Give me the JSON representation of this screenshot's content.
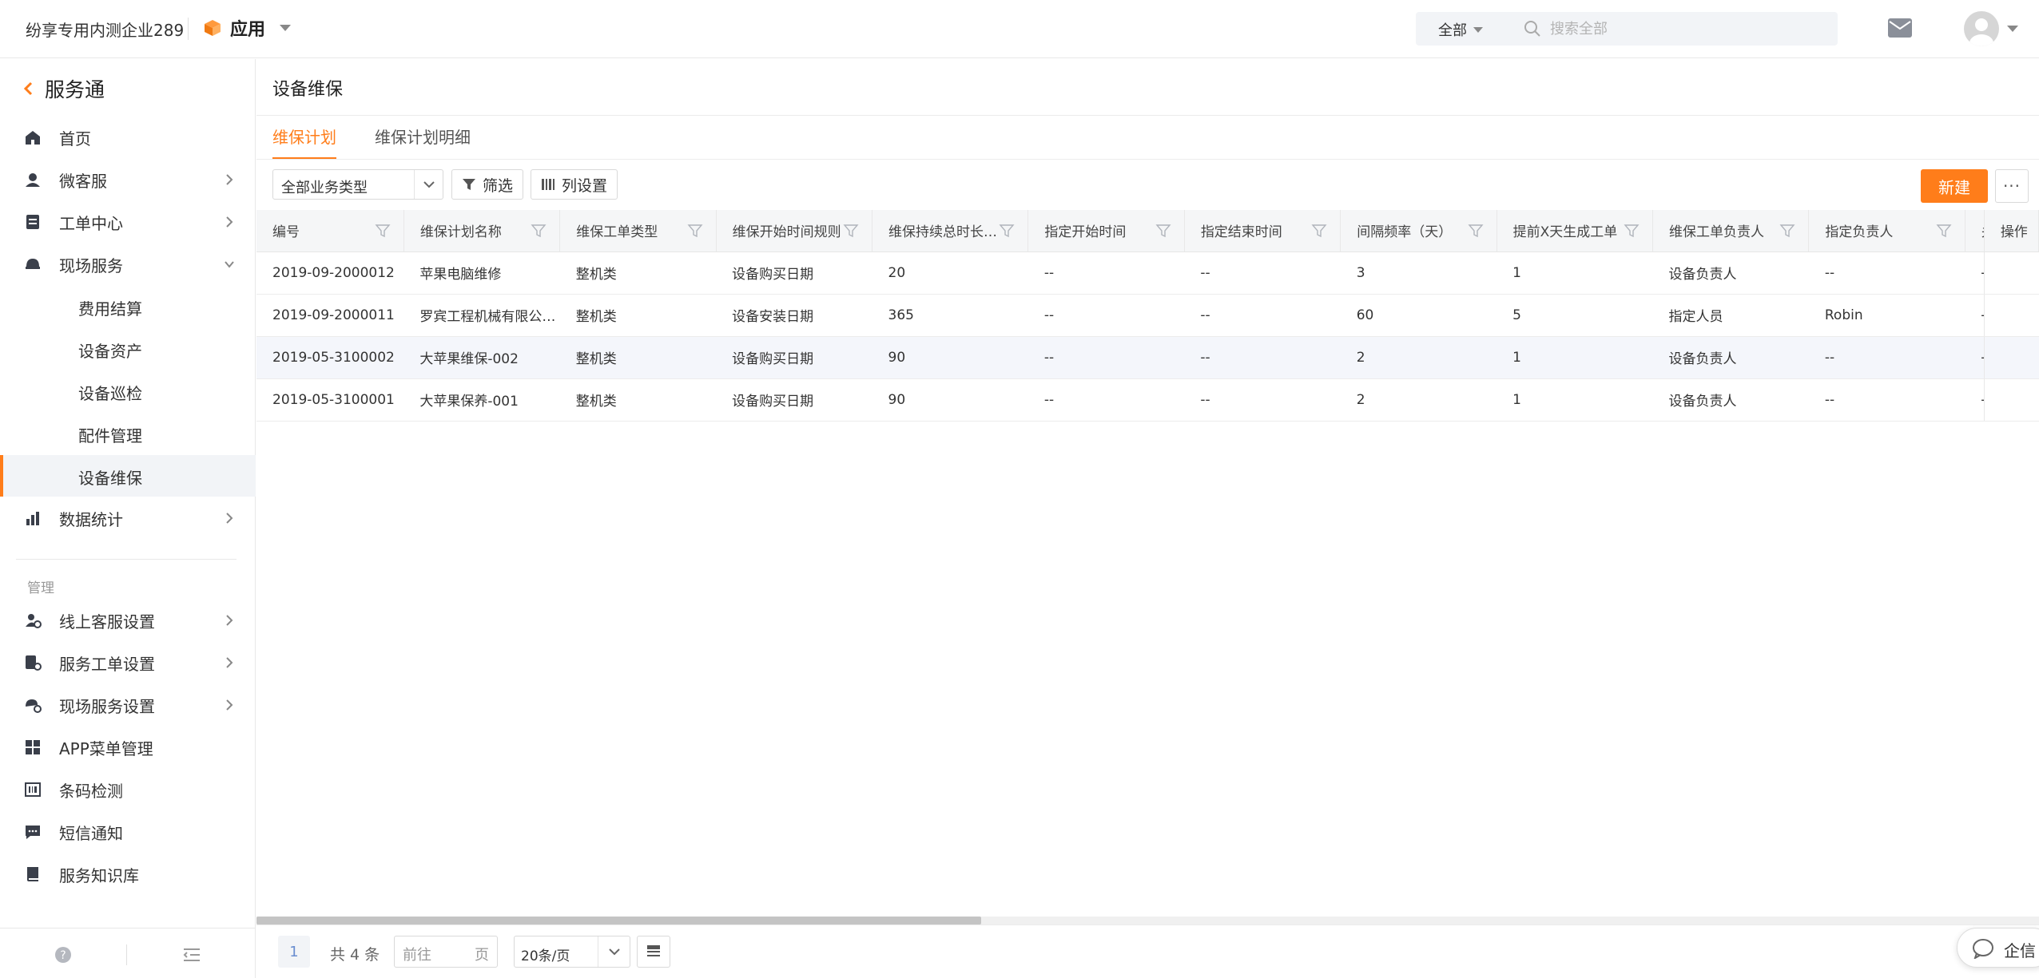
{
  "header": {
    "company": "纷享专用内测企业289",
    "app_label": "应用",
    "search_scope": "全部",
    "search_placeholder": "搜索全部"
  },
  "sidebar": {
    "title": "服务通",
    "items": [
      {
        "label": "首页",
        "icon": "home-icon"
      },
      {
        "label": "微客服",
        "icon": "customer-service-icon"
      },
      {
        "label": "工单中心",
        "icon": "ticket-icon"
      },
      {
        "label": "现场服务",
        "icon": "field-service-icon"
      }
    ],
    "subitems": [
      {
        "label": "费用结算"
      },
      {
        "label": "设备资产"
      },
      {
        "label": "设备巡检"
      },
      {
        "label": "配件管理"
      },
      {
        "label": "设备维保",
        "active": true
      }
    ],
    "stats": {
      "label": "数据统计",
      "icon": "bar-chart-icon"
    },
    "section_label": "管理",
    "admin_items": [
      {
        "label": "线上客服设置",
        "icon": "online-service-settings-icon"
      },
      {
        "label": "服务工单设置",
        "icon": "ticket-settings-icon"
      },
      {
        "label": "现场服务设置",
        "icon": "field-settings-icon"
      },
      {
        "label": "APP菜单管理",
        "icon": "app-menu-icon"
      },
      {
        "label": "条码检测",
        "icon": "barcode-icon"
      },
      {
        "label": "短信通知",
        "icon": "sms-icon"
      },
      {
        "label": "服务知识库",
        "icon": "knowledge-base-icon"
      }
    ]
  },
  "main": {
    "title": "设备维保",
    "tabs": [
      "维保计划",
      "维保计划明细"
    ],
    "active_tab": 0,
    "business_type": "全部业务类型",
    "filter_label": "筛选",
    "columns_label": "列设置",
    "new_label": "新建",
    "more_label": "···"
  },
  "table": {
    "headers": [
      "编号",
      "维保计划名称",
      "维保工单类型",
      "维保开始时间规则",
      "维保持续总时长…",
      "指定开始时间",
      "指定结束时间",
      "间隔频率（天）",
      "提前X天生成工单",
      "维保工单负责人",
      "指定负责人",
      "关",
      "操作"
    ],
    "rows": [
      [
        "2019-09-2000012",
        "苹果电脑维修",
        "整机类",
        "设备购买日期",
        "20",
        "--",
        "--",
        "3",
        "1",
        "设备负责人",
        "--",
        "--",
        ""
      ],
      [
        "2019-09-2000011",
        "罗宾工程机械有限公…",
        "整机类",
        "设备安装日期",
        "365",
        "--",
        "--",
        "60",
        "5",
        "指定人员",
        "Robin",
        "--",
        ""
      ],
      [
        "2019-05-3100002",
        "大苹果维保-002",
        "整机类",
        "设备购买日期",
        "90",
        "--",
        "--",
        "2",
        "1",
        "设备负责人",
        "--",
        "--",
        ""
      ],
      [
        "2019-05-3100001",
        "大苹果保养-001",
        "整机类",
        "设备购买日期",
        "90",
        "--",
        "--",
        "2",
        "1",
        "设备负责人",
        "--",
        "--",
        ""
      ]
    ],
    "highlighted_row": 2
  },
  "pager": {
    "current": "1",
    "total": "共 4 条",
    "goto_placeholder": "前往",
    "goto_unit": "页",
    "page_size": "20条/页"
  },
  "chat_widget": {
    "label": "企信"
  },
  "colors": {
    "accent": "#ff7d1a",
    "sidebar_active_bg": "#f2f4f7",
    "header_bg": "#f5f6f7"
  }
}
